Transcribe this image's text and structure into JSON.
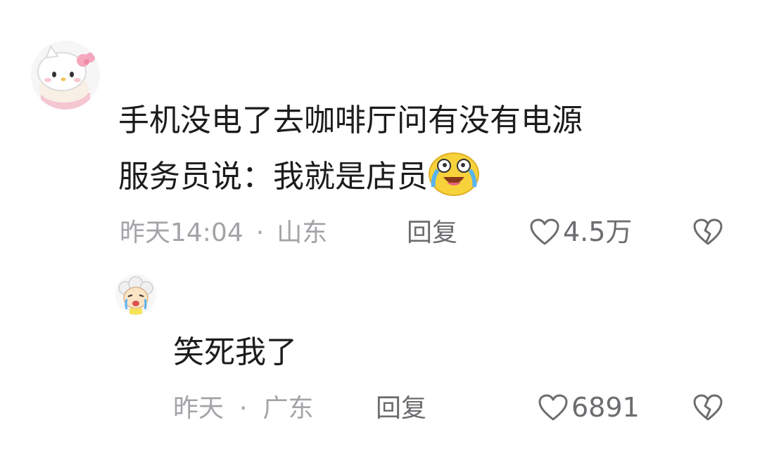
{
  "comments": [
    {
      "avatar_icon": "hello-kitty-avatar-icon",
      "text_line1": "手机没电了去咖啡厅问有没有电源",
      "text_line2": "服务员说：我就是店员",
      "emoji": "laughing-crying-emoji",
      "time": "昨天14:04",
      "sep": "·",
      "location": "山东",
      "reply_label": "回复",
      "like_count": "4.5万"
    },
    {
      "avatar_icon": "cartoon-sheep-avatar-icon",
      "text_line1": "笑死我了",
      "time": "昨天",
      "sep": "·",
      "location": "广东",
      "reply_label": "回复",
      "like_count": "6891"
    }
  ],
  "colors": {
    "text": "#1c1c1e",
    "meta": "#a3a3a8",
    "action": "#6c6c70",
    "background": "#ffffff"
  }
}
